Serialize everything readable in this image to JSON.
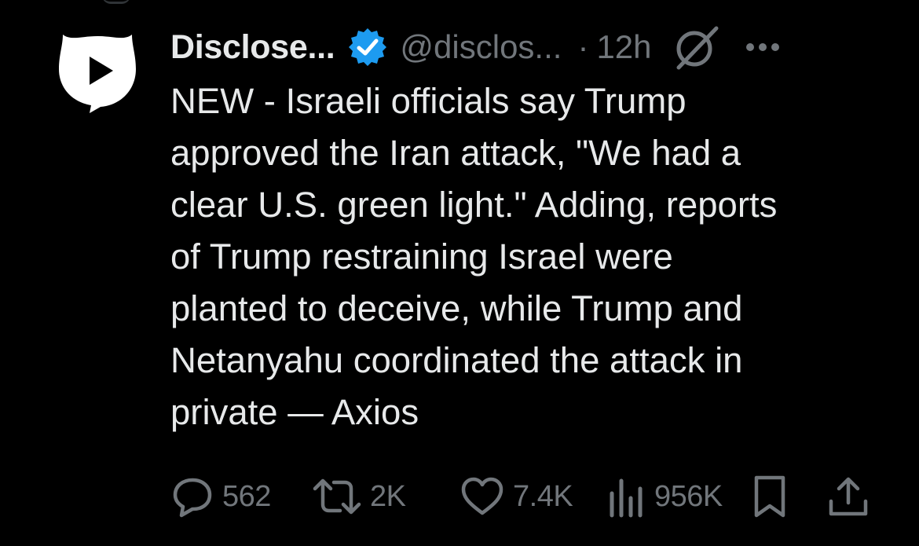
{
  "tweet": {
    "display_name": "Disclose...",
    "handle": "@disclos...",
    "separator": "·",
    "time": "12h",
    "text_lines": [
      "NEW - Israeli officials say Trump",
      "approved the Iran attack, \"We had a",
      "clear U.S. green light.\" Adding, reports",
      "of Trump restraining Israel were",
      "planted to deceive, while Trump and",
      "Netanyahu coordinated the attack in",
      "private — Axios"
    ]
  },
  "actions": {
    "replies": "562",
    "reposts": "2K",
    "likes": "7.4K",
    "views": "956K"
  },
  "icons": {
    "avatar": "play-bubble-avatar",
    "verified": "verified-badge-icon",
    "grok": "grok-icon",
    "more": "more-dots-icon",
    "reply": "reply-icon",
    "repost": "repost-icon",
    "like": "heart-icon",
    "views": "views-icon",
    "bookmark": "bookmark-icon",
    "share": "share-icon"
  },
  "colors": {
    "background": "#000000",
    "text": "#e7e9ea",
    "muted": "#71767b",
    "verified": "#1d9bf0"
  }
}
